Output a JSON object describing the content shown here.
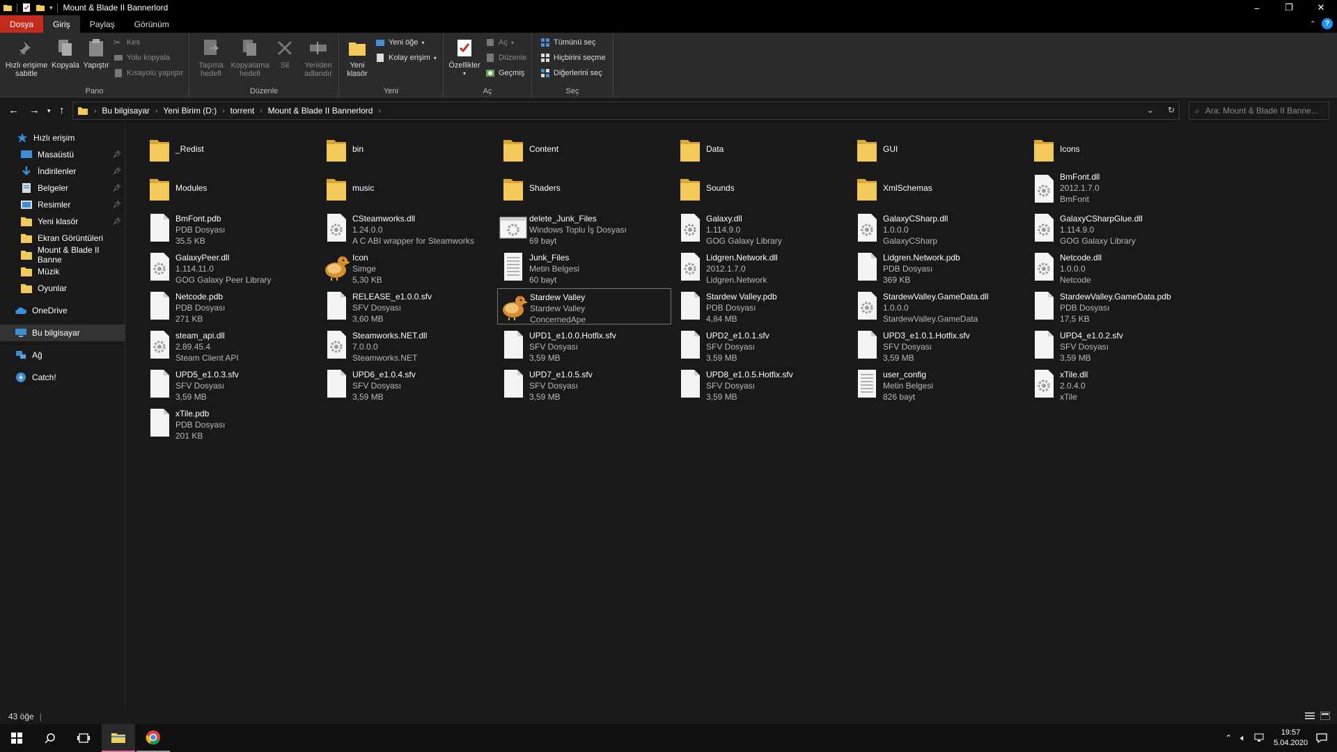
{
  "window": {
    "title": "Mount & Blade II Bannerlord",
    "controls": [
      "–",
      "❐",
      "✕"
    ]
  },
  "ribbon_tabs": [
    "Dosya",
    "Giriş",
    "Paylaş",
    "Görünüm"
  ],
  "ribbon": {
    "pano": {
      "label": "Pano",
      "pin": "Hızlı erişime\nsabitle",
      "copy": "Kopyala",
      "paste": "Yapıştır",
      "cut": "Kes",
      "copy_path": "Yolu kopyala",
      "paste_shortcut": "Kısayolu yapıştır"
    },
    "duzenle": {
      "label": "Düzenle",
      "move_to": "Taşıma\nhedefi",
      "copy_to": "Kopyalama\nhedefi",
      "delete": "Sil",
      "rename": "Yeniden\nadlandır"
    },
    "yeni": {
      "label": "Yeni",
      "new_folder": "Yeni\nklasör",
      "new_item": "Yeni öğe",
      "easy_access": "Kolay erişim"
    },
    "ac": {
      "label": "Aç",
      "properties": "Özellikler",
      "open": "Aç",
      "edit": "Düzenle",
      "history": "Geçmiş"
    },
    "sec": {
      "label": "Seç",
      "select_all": "Tümünü seç",
      "select_none": "Hiçbirini seçme",
      "invert": "Diğerlerini seç"
    }
  },
  "address": {
    "crumbs": [
      "Bu bilgisayar",
      "Yeni Birim (D:)",
      "torrent",
      "Mount & Blade II Bannerlord"
    ],
    "search_placeholder": "Ara: Mount & Blade II Banne..."
  },
  "sidebar": [
    {
      "label": "Hızlı erişim",
      "icon": "star-icon",
      "pinned": false
    },
    {
      "label": "Masaüstü",
      "icon": "desktop-icon",
      "pinned": true
    },
    {
      "label": "İndirilenler",
      "icon": "download-icon",
      "pinned": true
    },
    {
      "label": "Belgeler",
      "icon": "documents-icon",
      "pinned": true
    },
    {
      "label": "Resimler",
      "icon": "pictures-icon",
      "pinned": true
    },
    {
      "label": "Yeni klasör",
      "icon": "folder-icon",
      "pinned": true
    },
    {
      "label": "Ekran Görüntüleri",
      "icon": "folder-icon",
      "pinned": false
    },
    {
      "label": "Mount & Blade II Banne",
      "icon": "folder-icon",
      "pinned": false
    },
    {
      "label": "Müzik",
      "icon": "folder-icon",
      "pinned": false
    },
    {
      "label": "Oyunlar",
      "icon": "folder-icon",
      "pinned": false
    },
    {
      "label": "OneDrive",
      "icon": "cloud-icon",
      "pinned": false
    },
    {
      "label": "Bu bilgisayar",
      "icon": "computer-icon",
      "pinned": false
    },
    {
      "label": "Ağ",
      "icon": "network-icon",
      "pinned": false
    },
    {
      "label": "Catch!",
      "icon": "catch-icon",
      "pinned": false
    }
  ],
  "files": [
    {
      "name": "_Redist",
      "type": "folder",
      "l2": "",
      "l3": ""
    },
    {
      "name": "bin",
      "type": "folder",
      "l2": "",
      "l3": ""
    },
    {
      "name": "Content",
      "type": "folder",
      "l2": "",
      "l3": ""
    },
    {
      "name": "Data",
      "type": "folder",
      "l2": "",
      "l3": ""
    },
    {
      "name": "GUI",
      "type": "folder",
      "l2": "",
      "l3": ""
    },
    {
      "name": "Icons",
      "type": "folder",
      "l2": "",
      "l3": ""
    },
    {
      "name": "Modules",
      "type": "folder",
      "l2": "",
      "l3": ""
    },
    {
      "name": "music",
      "type": "folder",
      "l2": "",
      "l3": ""
    },
    {
      "name": "Shaders",
      "type": "folder",
      "l2": "",
      "l3": ""
    },
    {
      "name": "Sounds",
      "type": "folder",
      "l2": "",
      "l3": ""
    },
    {
      "name": "XmlSchemas",
      "type": "folder",
      "l2": "",
      "l3": ""
    },
    {
      "name": "BmFont.dll",
      "type": "dll",
      "l2": "2012.1.7.0",
      "l3": "BmFont"
    },
    {
      "name": "BmFont.pdb",
      "type": "file",
      "l2": "PDB Dosyası",
      "l3": "35,5 KB"
    },
    {
      "name": "CSteamworks.dll",
      "type": "dll",
      "l2": "1.24.0.0",
      "l3": "A C ABI wrapper for Steamworks"
    },
    {
      "name": "delete_Junk_Files",
      "type": "bat",
      "l2": "Windows Toplu İş Dosyası",
      "l3": "69 bayt"
    },
    {
      "name": "Galaxy.dll",
      "type": "dll",
      "l2": "1.114.9.0",
      "l3": "GOG Galaxy Library"
    },
    {
      "name": "GalaxyCSharp.dll",
      "type": "dll",
      "l2": "1.0.0.0",
      "l3": "GalaxyCSharp"
    },
    {
      "name": "GalaxyCSharpGlue.dll",
      "type": "dll",
      "l2": "1.114.9.0",
      "l3": "GOG Galaxy Library"
    },
    {
      "name": "GalaxyPeer.dll",
      "type": "dll",
      "l2": "1.114.11.0",
      "l3": "GOG Galaxy Peer Library"
    },
    {
      "name": "Icon",
      "type": "chicken",
      "l2": "Simge",
      "l3": "5,30 KB"
    },
    {
      "name": "Junk_Files",
      "type": "text",
      "l2": "Metin Belgesi",
      "l3": "60 bayt"
    },
    {
      "name": "Lidgren.Network.dll",
      "type": "dll",
      "l2": "2012.1.7.0",
      "l3": "Lidgren.Network"
    },
    {
      "name": "Lidgren.Network.pdb",
      "type": "file",
      "l2": "PDB Dosyası",
      "l3": "369 KB"
    },
    {
      "name": "Netcode.dll",
      "type": "dll",
      "l2": "1.0.0.0",
      "l3": "Netcode"
    },
    {
      "name": "Netcode.pdb",
      "type": "file",
      "l2": "PDB Dosyası",
      "l3": "271 KB"
    },
    {
      "name": "RELEASE_e1.0.0.sfv",
      "type": "file",
      "l2": "SFV Dosyası",
      "l3": "3,60 MB"
    },
    {
      "name": "Stardew Valley",
      "type": "chicken",
      "l2": "Stardew Valley",
      "l3": "ConcernedApe"
    },
    {
      "name": "Stardew Valley.pdb",
      "type": "file",
      "l2": "PDB Dosyası",
      "l3": "4,84 MB"
    },
    {
      "name": "StardewValley.GameData.dll",
      "type": "dll",
      "l2": "1.0.0.0",
      "l3": "StardewValley.GameData"
    },
    {
      "name": "StardewValley.GameData.pdb",
      "type": "file",
      "l2": "PDB Dosyası",
      "l3": "17,5 KB"
    },
    {
      "name": "steam_api.dll",
      "type": "dll",
      "l2": "2.89.45.4",
      "l3": "Steam Client API"
    },
    {
      "name": "Steamworks.NET.dll",
      "type": "dll",
      "l2": "7.0.0.0",
      "l3": "Steamworks.NET"
    },
    {
      "name": "UPD1_e1.0.0.Hotfix.sfv",
      "type": "file",
      "l2": "SFV Dosyası",
      "l3": "3,59 MB"
    },
    {
      "name": "UPD2_e1.0.1.sfv",
      "type": "file",
      "l2": "SFV Dosyası",
      "l3": "3,59 MB"
    },
    {
      "name": "UPD3_e1.0.1.Hotfix.sfv",
      "type": "file",
      "l2": "SFV Dosyası",
      "l3": "3,59 MB"
    },
    {
      "name": "UPD4_e1.0.2.sfv",
      "type": "file",
      "l2": "SFV Dosyası",
      "l3": "3,59 MB"
    },
    {
      "name": "UPD5_e1.0.3.sfv",
      "type": "file",
      "l2": "SFV Dosyası",
      "l3": "3,59 MB"
    },
    {
      "name": "UPD6_e1.0.4.sfv",
      "type": "file",
      "l2": "SFV Dosyası",
      "l3": "3,59 MB"
    },
    {
      "name": "UPD7_e1.0.5.sfv",
      "type": "file",
      "l2": "SFV Dosyası",
      "l3": "3,59 MB"
    },
    {
      "name": "UPD8_e1.0.5.Hotfix.sfv",
      "type": "file",
      "l2": "SFV Dosyası",
      "l3": "3,59 MB"
    },
    {
      "name": "user_config",
      "type": "text",
      "l2": "Metin Belgesi",
      "l3": "826 bayt"
    },
    {
      "name": "xTile.dll",
      "type": "dll",
      "l2": "2.0.4.0",
      "l3": "xTile"
    },
    {
      "name": "xTile.pdb",
      "type": "file",
      "l2": "PDB Dosyası",
      "l3": "201 KB"
    }
  ],
  "selected_file": "Stardew Valley",
  "status": {
    "count": "43 öğe"
  },
  "taskbar": {
    "time": "19:57",
    "date": "5.04.2020"
  },
  "colors": {
    "accent_file_tab": "#c42b1c",
    "folder_yellow": "#f3c95a",
    "taskbar_active": "#e06c9f"
  }
}
